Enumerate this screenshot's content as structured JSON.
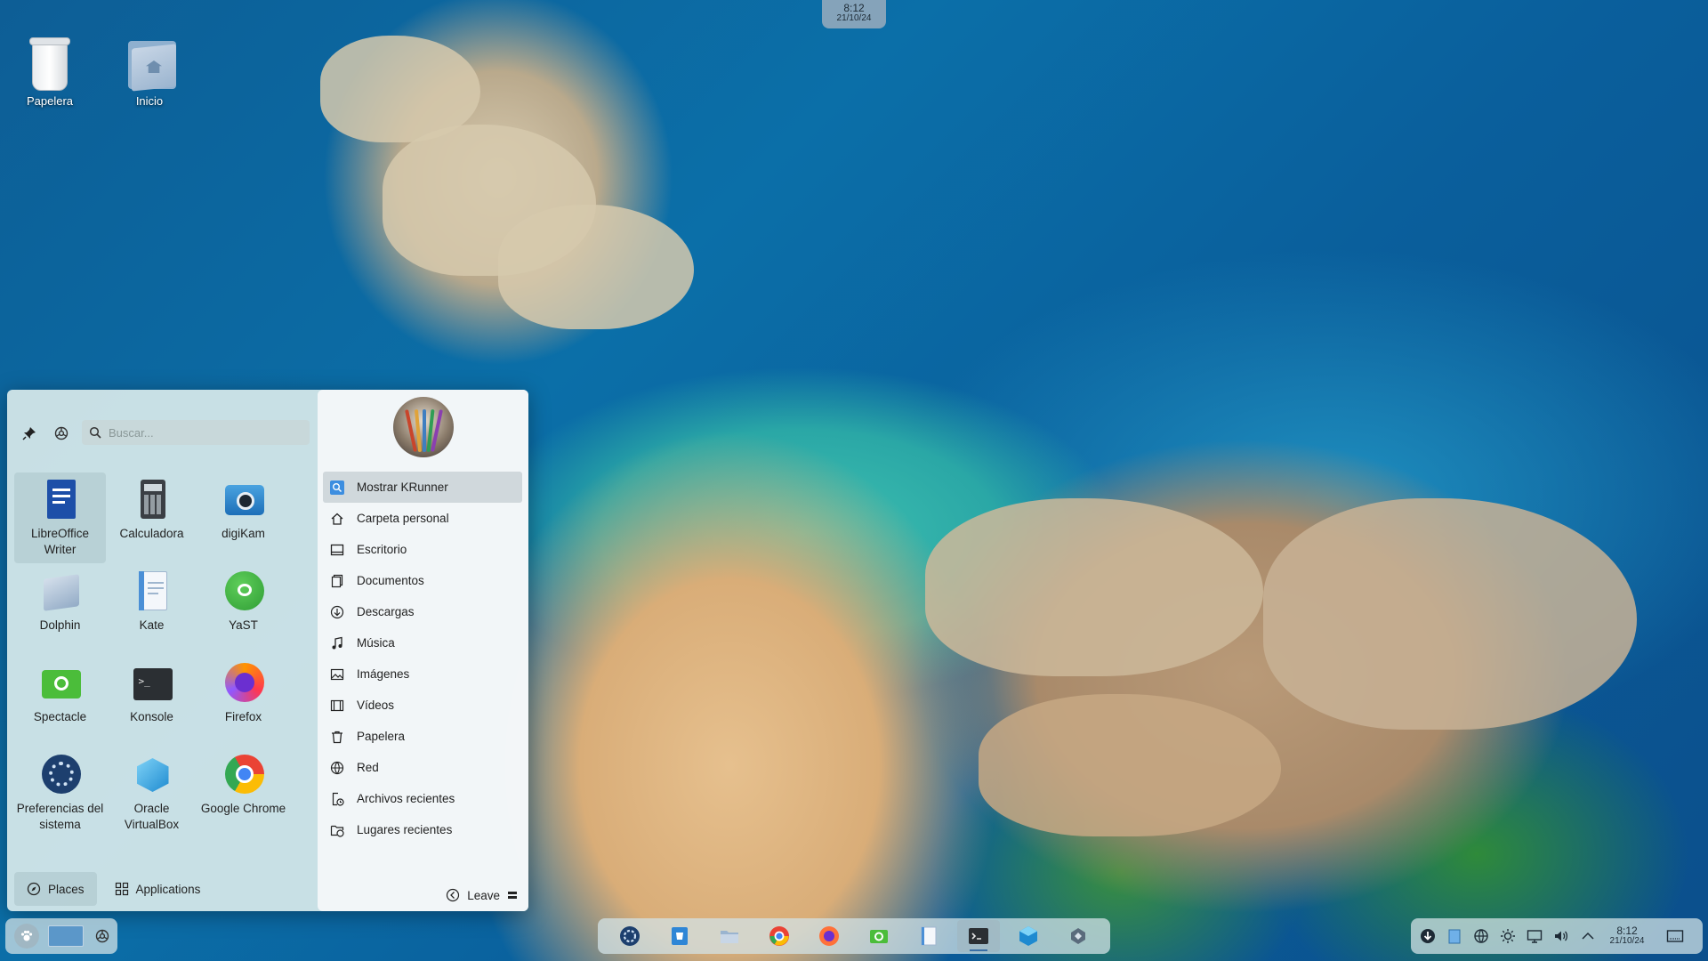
{
  "top_clock": {
    "time": "8:12",
    "date": "21/10/24"
  },
  "desktop_icons": [
    {
      "label": "Papelera",
      "icon": "trash-icon"
    },
    {
      "label": "Inicio",
      "icon": "home-folder-icon"
    }
  ],
  "launcher": {
    "search": {
      "placeholder": "Buscar..."
    },
    "apps": [
      {
        "label": "LibreOffice Writer",
        "icon": "libreoffice-writer-icon"
      },
      {
        "label": "Calculadora",
        "icon": "calculator-icon"
      },
      {
        "label": "digiKam",
        "icon": "digikam-icon"
      },
      {
        "label": "Dolphin",
        "icon": "dolphin-icon"
      },
      {
        "label": "Kate",
        "icon": "kate-icon"
      },
      {
        "label": "YaST",
        "icon": "yast-icon"
      },
      {
        "label": "Spectacle",
        "icon": "spectacle-icon"
      },
      {
        "label": "Konsole",
        "icon": "konsole-icon"
      },
      {
        "label": "Firefox",
        "icon": "firefox-icon"
      },
      {
        "label": "Preferencias del sistema",
        "icon": "system-settings-icon"
      },
      {
        "label": "Oracle VirtualBox",
        "icon": "virtualbox-icon"
      },
      {
        "label": "Google Chrome",
        "icon": "chrome-icon"
      }
    ],
    "tabs": {
      "places": "Places",
      "applications": "Applications"
    },
    "places": [
      {
        "label": "Mostrar KRunner",
        "icon": "search-icon"
      },
      {
        "label": "Carpeta personal",
        "icon": "home-icon"
      },
      {
        "label": "Escritorio",
        "icon": "desktop-icon"
      },
      {
        "label": "Documentos",
        "icon": "documents-icon"
      },
      {
        "label": "Descargas",
        "icon": "download-icon"
      },
      {
        "label": "Música",
        "icon": "music-icon"
      },
      {
        "label": "Imágenes",
        "icon": "image-icon"
      },
      {
        "label": "Vídeos",
        "icon": "video-icon"
      },
      {
        "label": "Papelera",
        "icon": "trash-icon"
      },
      {
        "label": "Red",
        "icon": "network-icon"
      },
      {
        "label": "Archivos recientes",
        "icon": "recent-files-icon"
      },
      {
        "label": "Lugares recientes",
        "icon": "recent-places-icon"
      }
    ],
    "leave_label": "Leave"
  },
  "dock_apps": [
    "yast-icon",
    "discover-icon",
    "dolphin-icon",
    "chrome-icon",
    "firefox-icon",
    "spectacle-icon",
    "kate-icon",
    "konsole-icon",
    "virtualbox-icon",
    "kde-connect-icon"
  ],
  "tray": {
    "icons": [
      "update-icon",
      "clipboard-icon",
      "network-icon",
      "brightness-icon",
      "display-icon",
      "volume-icon",
      "expand-icon"
    ],
    "time": "8:12",
    "date": "21/10/24"
  },
  "colors": {
    "accent": "#3a6ea5",
    "panel": "#d2e1e6"
  }
}
